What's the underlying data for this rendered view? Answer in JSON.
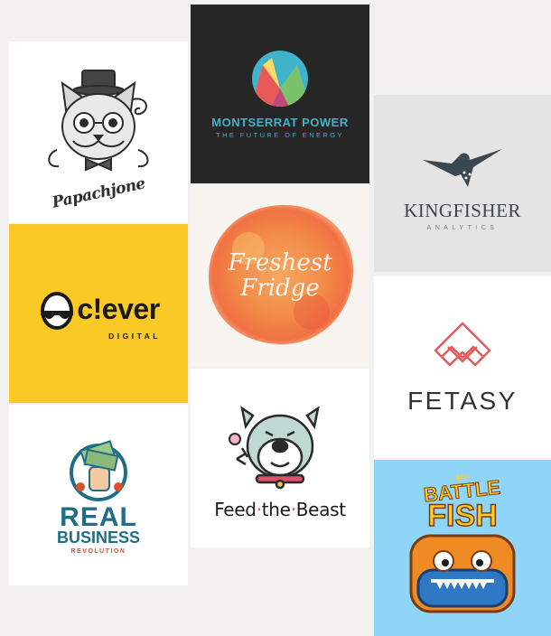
{
  "logos": {
    "papachjone": {
      "name": "Papachjone"
    },
    "montserrat": {
      "title": "MONTSERRAT POWER",
      "tagline": "THE FUTURE OF ENERGY"
    },
    "kingfisher": {
      "title": "KINGFISHER",
      "tagline": "ANALYTICS"
    },
    "clever": {
      "word": "c!ever",
      "sub": "DIGITAL"
    },
    "fridge": {
      "line1": "Freshest",
      "line2": "Fridge"
    },
    "fetasy": {
      "word": "FETASY"
    },
    "beast": {
      "word1": "Feed",
      "word2": "the",
      "word3": "Beast"
    },
    "realbusiness": {
      "line1": "REAL",
      "line2": "BUSINESS",
      "tagline": "REVOLUTION"
    },
    "battlefish": {
      "my": "MY",
      "battle": "BATTLE",
      "fish": "FISH"
    }
  },
  "colors": {
    "background": "#f2f1ef",
    "clever_yellow": "#fbc925",
    "montserrat_dark": "#262626",
    "montserrat_teal": "#3fb3c9",
    "fetasy_red": "#e8595a",
    "battlefish_sky": "#8fd5f7",
    "realbusiness_teal": "#1f6e86"
  }
}
